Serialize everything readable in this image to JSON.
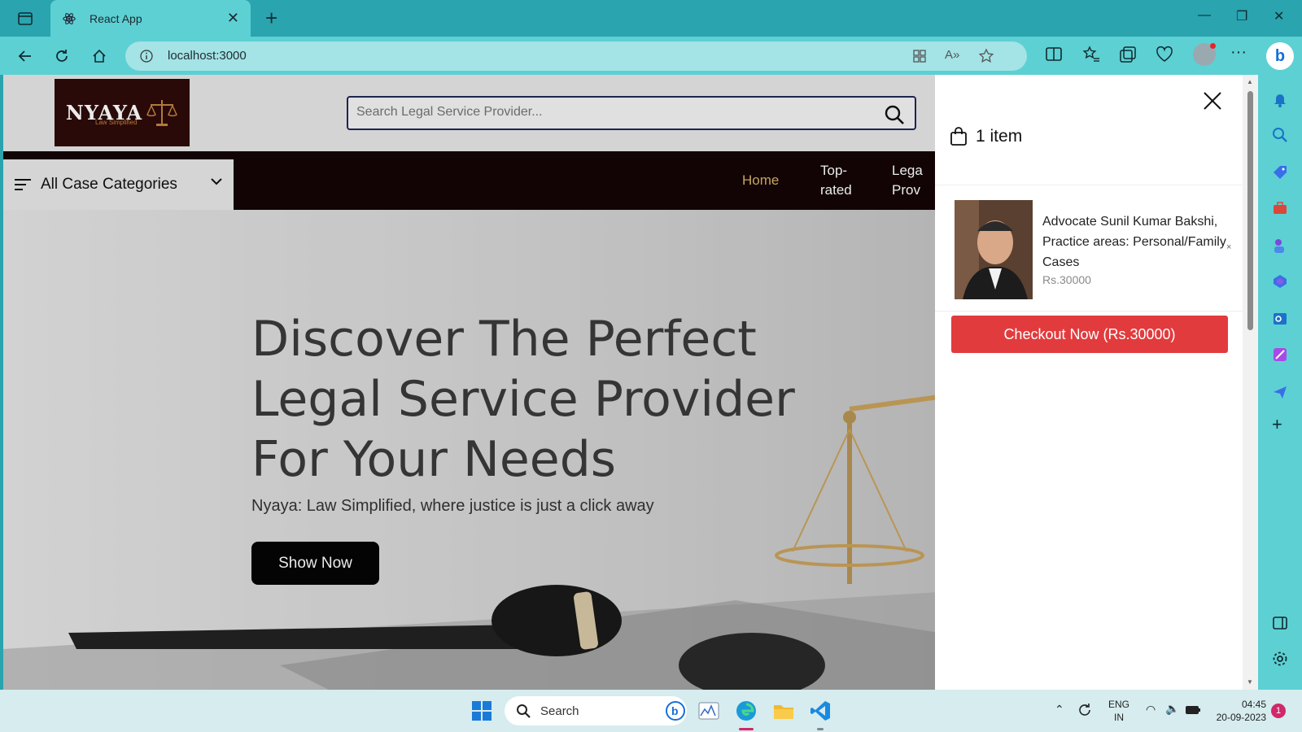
{
  "browser": {
    "tab_title": "React App",
    "url": "localhost:3000"
  },
  "site": {
    "logo_text": "NYAYA",
    "logo_tagline": "Law Simplified",
    "search_placeholder": "Search Legal Service Provider...",
    "categories_label": "All Case Categories",
    "nav": [
      {
        "label": "Home",
        "active": true
      },
      {
        "label": "Top-\nrated"
      },
      {
        "label": "Lega\nProv"
      }
    ],
    "hero": {
      "title_line1": "Discover The Perfect",
      "title_line2": "Legal Service Provider",
      "title_line3": "For Your Needs",
      "subtitle": "Nyaya: Law Simplified, where justice is just a click away",
      "cta": "Show Now"
    }
  },
  "cart": {
    "count_label": "1 item",
    "item": {
      "name": "Advocate Sunil Kumar Bakshi, Practice areas: Personal/Family Cases",
      "price": "Rs.30000",
      "remove": "×"
    },
    "checkout_label": "Checkout Now (Rs.30000)"
  },
  "taskbar": {
    "search_label": "Search",
    "lang_top": "ENG",
    "lang_bottom": "IN",
    "time": "04:45",
    "date": "20-09-2023",
    "notif_count": "1"
  },
  "colors": {
    "accent_nav_active": "#d8b26a",
    "checkout": "#e23b3d",
    "menubar": "#140506"
  }
}
